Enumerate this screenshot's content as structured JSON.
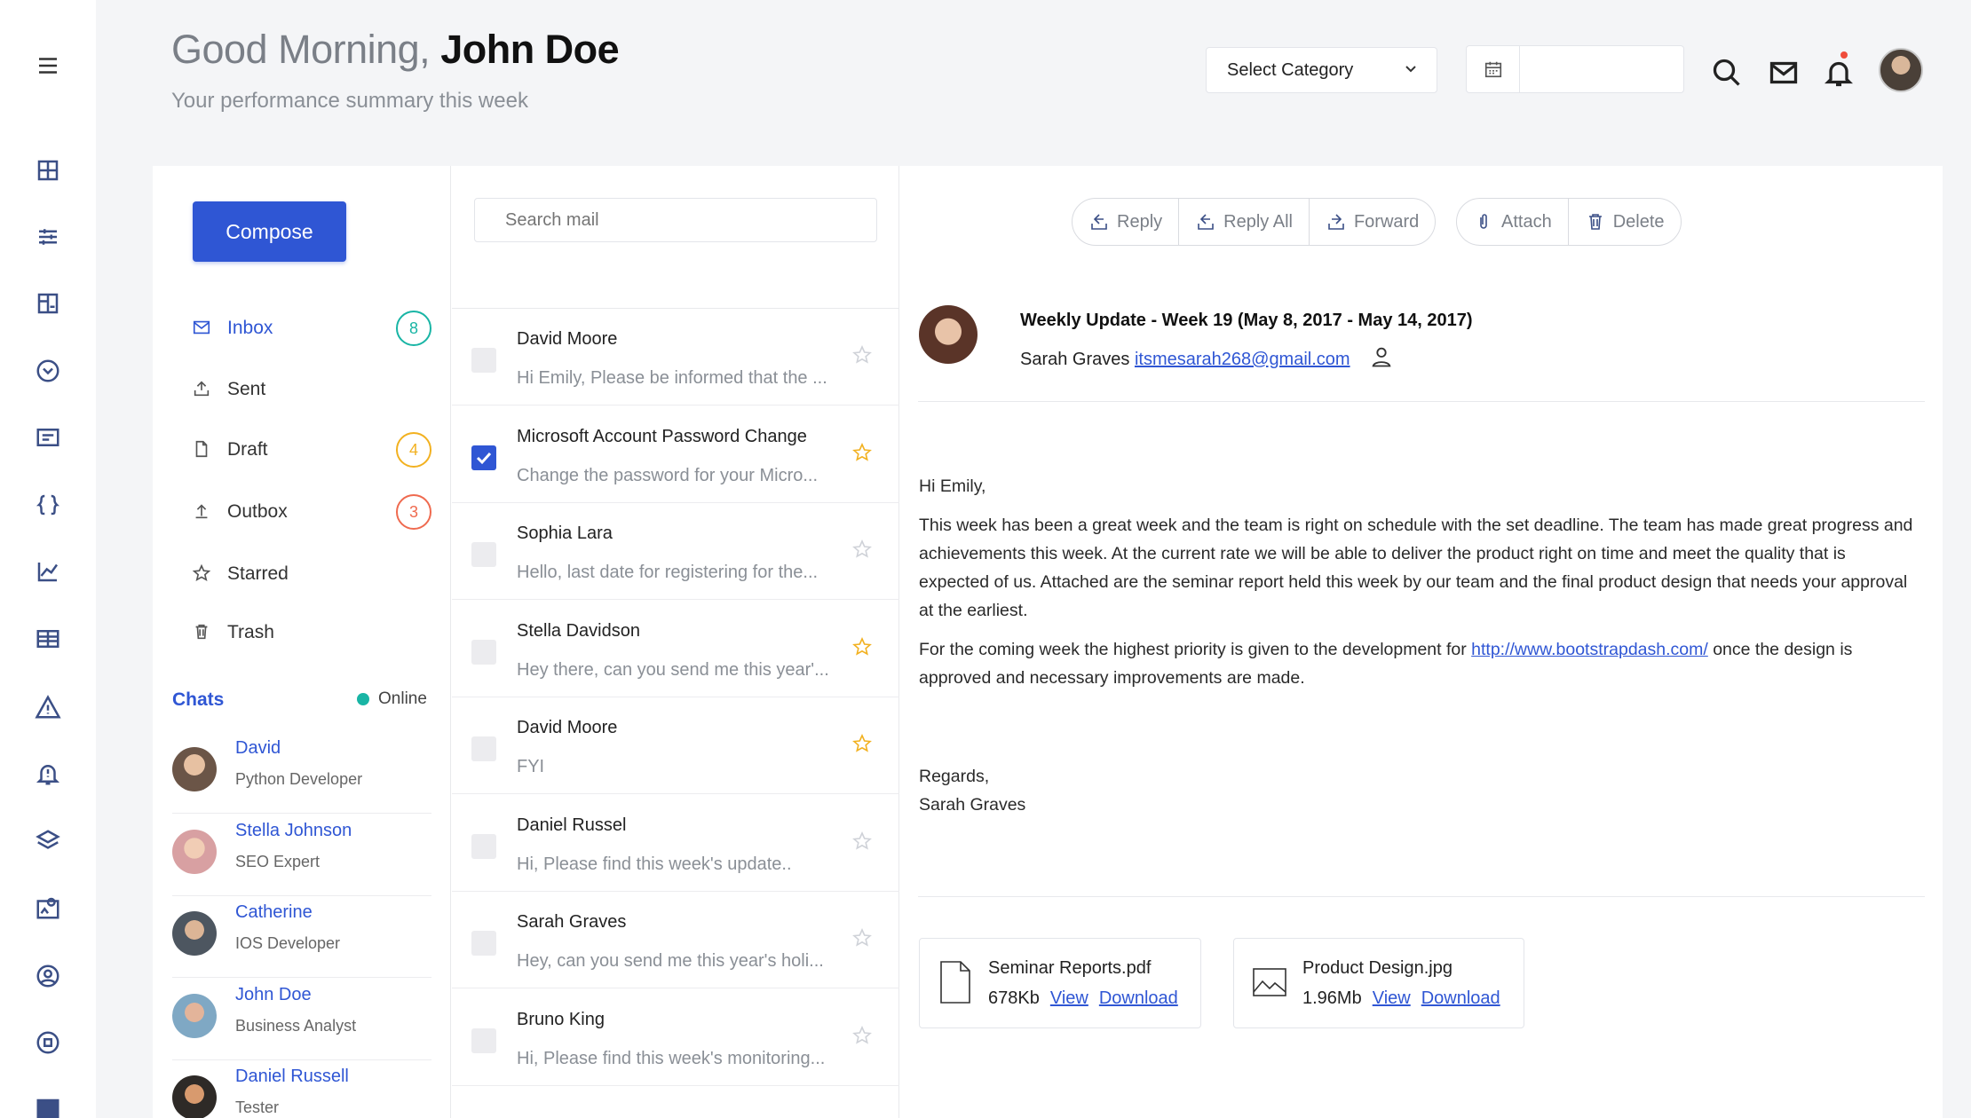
{
  "header": {
    "greeting": "Good Morning,",
    "user_name": "John Doe",
    "subtitle": "Your performance summary this week",
    "category_select": "Select Category"
  },
  "sidebar_icons": [
    "menu-icon",
    "dashboard-icon",
    "sliders-icon",
    "layout-icon",
    "chevron-circle-icon",
    "card-icon",
    "code-braces-icon",
    "chart-line-icon",
    "table-icon",
    "warning-icon",
    "bell-alert-icon",
    "layers-icon",
    "map-icon",
    "user-circle-icon",
    "record-icon",
    "book-icon"
  ],
  "folders": {
    "compose": "Compose",
    "items": [
      {
        "label": "Inbox",
        "badge": "8",
        "badge_color": "#19b5a5"
      },
      {
        "label": "Sent"
      },
      {
        "label": "Draft",
        "badge": "4",
        "badge_color": "#f2b120"
      },
      {
        "label": "Outbox",
        "badge": "3",
        "badge_color": "#ef6a4f"
      },
      {
        "label": "Starred"
      },
      {
        "label": "Trash"
      }
    ]
  },
  "chats": {
    "title": "Chats",
    "status": "Online",
    "people": [
      {
        "name": "David",
        "role": "Python Developer"
      },
      {
        "name": "Stella Johnson",
        "role": "SEO Expert"
      },
      {
        "name": "Catherine",
        "role": "IOS Developer"
      },
      {
        "name": "John Doe",
        "role": "Business Analyst"
      },
      {
        "name": "Daniel Russell",
        "role": "Tester"
      }
    ]
  },
  "mail_list": {
    "search_placeholder": "Search mail",
    "mails": [
      {
        "from": "David Moore",
        "preview": "Hi Emily, Please be informed that the ...",
        "checked": false,
        "starred": false
      },
      {
        "from": "Microsoft Account Password Change",
        "preview": "Change the password for your Micro...",
        "checked": true,
        "starred": true
      },
      {
        "from": "Sophia Lara",
        "preview": "Hello, last date for registering for the...",
        "checked": false,
        "starred": false
      },
      {
        "from": "Stella Davidson",
        "preview": "Hey there, can you send me this year'...",
        "checked": false,
        "starred": true
      },
      {
        "from": "David Moore",
        "preview": "FYI",
        "checked": false,
        "starred": true
      },
      {
        "from": "Daniel Russel",
        "preview": "Hi, Please find this week's update..",
        "checked": false,
        "starred": false
      },
      {
        "from": "Sarah Graves",
        "preview": "Hey, can you send me this year's holi...",
        "checked": false,
        "starred": false
      },
      {
        "from": "Bruno King",
        "preview": "Hi, Please find this week's monitoring...",
        "checked": false,
        "starred": false
      }
    ]
  },
  "toolbar": {
    "reply": "Reply",
    "reply_all": "Reply All",
    "forward": "Forward",
    "attach": "Attach",
    "delete": "Delete"
  },
  "message": {
    "subject": "Weekly Update - Week 19 (May 8, 2017 - May 14, 2017)",
    "sender_name": "Sarah Graves",
    "sender_email": "itsmesarah268@gmail.com",
    "greeting": "Hi Emily,",
    "paragraph1": "This week has been a great week and the team is right on schedule with the set deadline. The team has made great progress and achievements this week. At the current rate we will be able to deliver the product right on time and meet the quality that is expected of us. Attached are the seminar report held this week by our team and the final product design that needs your approval at the earliest.",
    "paragraph2_before": "For the coming week the highest priority is given to the development for ",
    "paragraph2_link": "http://www.bootstrapdash.com/",
    "paragraph2_after": " once the design is approved and necessary improvements are made.",
    "regards": "Regards,",
    "signature": "Sarah Graves"
  },
  "attachments": [
    {
      "name": "Seminar Reports.pdf",
      "size": "678Kb",
      "view": "View",
      "download": "Download",
      "icon": "file-icon"
    },
    {
      "name": "Product Design.jpg",
      "size": "1.96Mb",
      "view": "View",
      "download": "Download",
      "icon": "image-icon"
    }
  ]
}
